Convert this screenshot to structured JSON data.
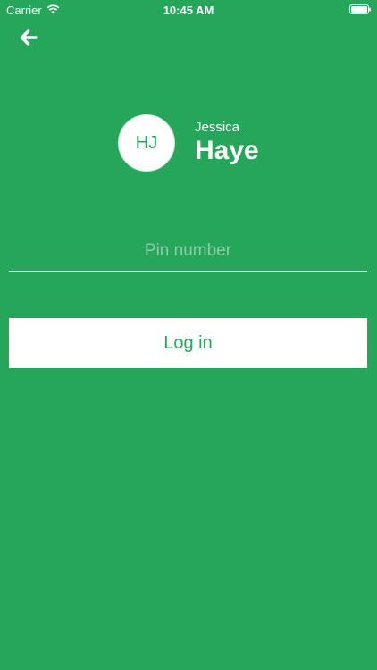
{
  "status_bar": {
    "carrier": "Carrier",
    "time": "10:45 AM",
    "wifi_icon": "wifi-icon",
    "battery_icon": "battery-icon"
  },
  "navigation": {
    "back_icon": "back-arrow-icon"
  },
  "user": {
    "initials": "HJ",
    "first_name": "Jessica",
    "last_name": "Haye"
  },
  "pin_field": {
    "placeholder": "Pin number",
    "value": ""
  },
  "login_button": {
    "label": "Log in"
  },
  "colors": {
    "background": "#26a65b",
    "foreground": "#ffffff",
    "accent": "#26a65b"
  }
}
